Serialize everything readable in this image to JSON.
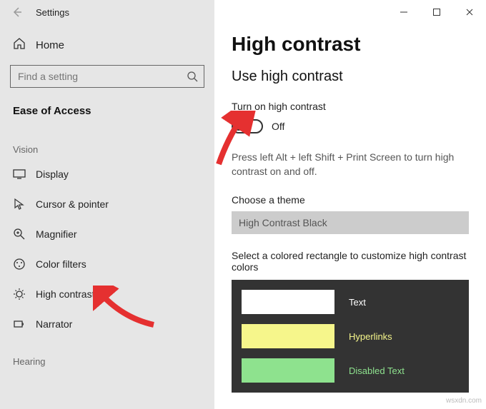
{
  "app": {
    "title": "Settings"
  },
  "sidebar": {
    "home": "Home",
    "search_placeholder": "Find a setting",
    "category": "Ease of Access",
    "groups": [
      {
        "label": "Vision",
        "items": [
          {
            "label": "Display"
          },
          {
            "label": "Cursor & pointer"
          },
          {
            "label": "Magnifier"
          },
          {
            "label": "Color filters"
          },
          {
            "label": "High contrast"
          },
          {
            "label": "Narrator"
          }
        ]
      },
      {
        "label": "Hearing",
        "items": []
      }
    ]
  },
  "main": {
    "title": "High contrast",
    "section": "Use high contrast",
    "toggle_label": "Turn on high contrast",
    "toggle_state": "Off",
    "shortcut_hint": "Press left Alt + left Shift + Print Screen to turn high contrast on and off.",
    "theme_label": "Choose a theme",
    "theme_value": "High Contrast Black",
    "customize_label": "Select a colored rectangle to customize high contrast colors",
    "swatches": [
      {
        "color": "#ffffff",
        "label": "Text",
        "label_color": "#ffffff"
      },
      {
        "color": "#f6f68b",
        "label": "Hyperlinks",
        "label_color": "#f6f68b"
      },
      {
        "color": "#8ee28e",
        "label": "Disabled Text",
        "label_color": "#8ee28e"
      }
    ]
  },
  "watermark": "wsxdn.com"
}
